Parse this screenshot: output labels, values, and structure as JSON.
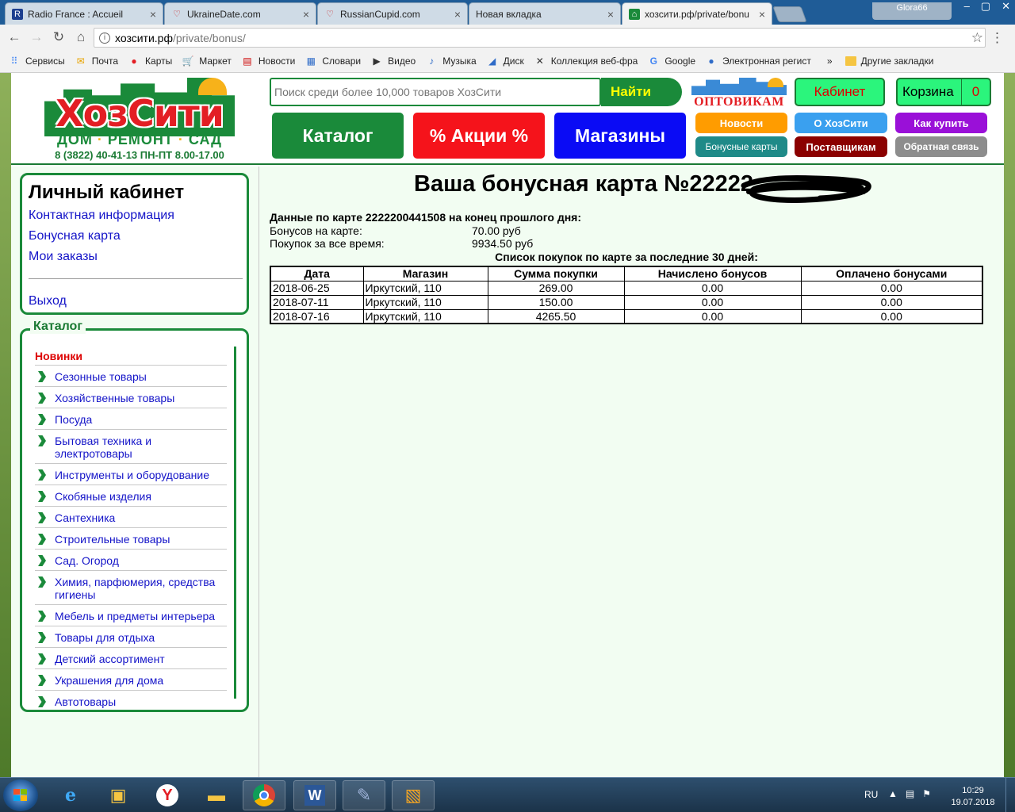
{
  "browser": {
    "tabs": [
      {
        "title": "Radio France : Accueil",
        "icon": "radio-france-icon",
        "active": false
      },
      {
        "title": "UkraineDate.com",
        "icon": "heart-icon",
        "active": false
      },
      {
        "title": "RussianCupid.com",
        "icon": "heart-icon",
        "active": false
      },
      {
        "title": "Новая вкладка",
        "icon": "",
        "active": false
      },
      {
        "title": "хозсити.рф/private/bonu",
        "icon": "home-icon",
        "active": true
      }
    ],
    "profile_name": "Glora66",
    "url_host": "хозсити.рф",
    "url_path": "/private/bonus/",
    "bookmarks": [
      {
        "label": "Сервисы",
        "icon": "apps-grid-icon"
      },
      {
        "label": "Почта",
        "icon": "mail-icon"
      },
      {
        "label": "Карты",
        "icon": "map-pin-icon"
      },
      {
        "label": "Маркет",
        "icon": "cart-icon"
      },
      {
        "label": "Новости",
        "icon": "news-icon"
      },
      {
        "label": "Словари",
        "icon": "dictionary-icon"
      },
      {
        "label": "Видео",
        "icon": "video-icon"
      },
      {
        "label": "Музыка",
        "icon": "music-icon"
      },
      {
        "label": "Диск",
        "icon": "disk-icon"
      },
      {
        "label": "Коллекция веб-фра",
        "icon": "collection-icon"
      },
      {
        "label": "Google",
        "icon": "google-icon"
      },
      {
        "label": "Электронная регист",
        "icon": "registration-icon"
      }
    ],
    "bookmarks_more": "»",
    "other_bookmarks": "Другие закладки"
  },
  "header": {
    "logo_name": "ХозСити",
    "logo_sub": [
      "ДОМ",
      "РЕМОНТ",
      "САД"
    ],
    "logo_phone": "8 (3822) 40-41-13 ПН-ПТ 8.00-17.00",
    "search_placeholder": "Поиск среди более 10,000 товаров ХозСити",
    "search_button": "Найти",
    "big_buttons": {
      "catalog": "Каталог",
      "sales": "% Акции %",
      "shops": "Магазины"
    },
    "wholesale_logo": "ОПТОВИКАМ",
    "cabinet_button": "Кабинет",
    "cart_label": "Корзина",
    "cart_count": "0",
    "small_buttons": {
      "news": "Новости",
      "about": "О ХозСити",
      "how_to_buy": "Как купить",
      "bonus_cards": "Бонусные карты",
      "suppliers": "Поставщикам",
      "feedback": "Обратная связь"
    },
    "colors": {
      "brand_green": "#1a8a3a",
      "brand_red": "#e31e24",
      "sun_yellow": "#f7b21a"
    }
  },
  "sidebar": {
    "cabinet_title": "Личный кабинет",
    "cabinet_links": [
      "Контактная информация",
      "Бонусная карта",
      "Мои заказы"
    ],
    "logout": "Выход",
    "catalog_title": "Каталог",
    "catalog_new": "Новинки",
    "catalog_items": [
      "Сезонные товары",
      "Хозяйственные товары",
      "Посуда",
      "Бытовая техника и электротовары",
      "Инструменты и оборудование",
      "Скобяные изделия",
      "Сантехника",
      "Строительные товары",
      "Сад. Огород",
      "Химия, парфюмерия, средства гигиены",
      "Мебель и предметы интерьера",
      "Товары для отдыха",
      "Детский ассортимент",
      "Украшения для дома",
      "Автотовары"
    ]
  },
  "main": {
    "title": "Ваша бонусная карта №22222",
    "card_heading": "Данные по карте 2222200441508 на конец прошлого дня:",
    "bonus_label": "Бонусов на карте:",
    "bonus_value": "70.00 руб",
    "total_label": "Покупок за все время:",
    "total_value": "9934.50 руб",
    "list_title": "Список покупок по карте за последние 30 дней:",
    "table": {
      "headers": [
        "Дата",
        "Магазин",
        "Сумма покупки",
        "Начислено бонусов",
        "Оплачено бонусами"
      ],
      "rows": [
        [
          "2018-06-25",
          "Иркутский, 110",
          "269.00",
          "0.00",
          "0.00"
        ],
        [
          "2018-07-11",
          "Иркутский, 110",
          "150.00",
          "0.00",
          "0.00"
        ],
        [
          "2018-07-16",
          "Иркутский, 110",
          "4265.50",
          "0.00",
          "0.00"
        ]
      ]
    }
  },
  "taskbar": {
    "apps": [
      "ie-icon",
      "notes-icon",
      "yandex-icon",
      "explorer-icon",
      "chrome-icon",
      "word-icon",
      "tool-icon",
      "paint-icon"
    ],
    "language": "RU",
    "time": "10:29",
    "date": "19.07.2018"
  }
}
